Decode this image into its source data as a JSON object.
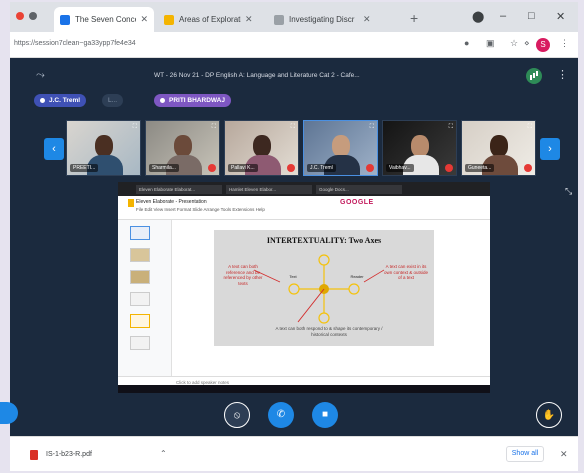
{
  "browser": {
    "tabs": [
      {
        "title": "The Seven Concep",
        "fav": "#1a73e8",
        "active": true
      },
      {
        "title": "Areas of Explorati",
        "fav": "#f4b400",
        "active": false
      },
      {
        "title": "Investigating Discr",
        "fav": "#5f6368",
        "active": false
      }
    ],
    "new_tab": "+",
    "url": "https://session7clean~ga33ypp7fe4e34",
    "profile_initial": "S"
  },
  "meeting": {
    "title": "WT - 26 Nov 21 - DP English A: Language and Literature Cat 2 - Cafe...",
    "pills": [
      {
        "label": "J.C. Treml",
        "color": "#3f51b5"
      },
      {
        "label": "L...",
        "color": "#2d3e55"
      },
      {
        "label": "PRITI BHARDWAJ",
        "color": "#7e57c2"
      }
    ],
    "participants": [
      {
        "name": "PREETI..."
      },
      {
        "name": "Sharmila..."
      },
      {
        "name": "Pallavi K..."
      },
      {
        "name": "J.C. Treml"
      },
      {
        "name": "Vaibhav..."
      },
      {
        "name": "Guneeta..."
      }
    ],
    "prev_arrow": "‹",
    "next_arrow": "›"
  },
  "shared_screen": {
    "tabs": [
      "Eleven Elaborate Elaborat...",
      "Hamlet Eleven Elabor...",
      "Google Docs..."
    ],
    "doc_title": "Eleven Elaborate - Presentation",
    "menu": "File  Edit  View  Insert  Format  Slide  Arrange  Tools  Extensions  Help",
    "brand_text": "GOOGLE",
    "slide": {
      "title": "INTERTEXTUALITY: Two Axes",
      "left_text": "A text can both reference and be referenced by other texts",
      "right_text": "A text can exist in its own context & outside of a text",
      "left_label": "Text",
      "right_label": "Reader",
      "bottom_text": "A text can both respond to & shape its contemporary / historical contexts"
    },
    "speaker_notes": "Click to add speaker notes"
  },
  "controls": [
    {
      "name": "mic-muted-button",
      "icon": "⦸"
    },
    {
      "name": "phone-button",
      "icon": "✆"
    },
    {
      "name": "camera-button",
      "icon": "■"
    },
    {
      "name": "raise-hand-button",
      "icon": "✋"
    }
  ],
  "download_bar": {
    "file_name": "IS-1-b23-R.pdf",
    "show_all": "Show all",
    "close": "✕"
  }
}
